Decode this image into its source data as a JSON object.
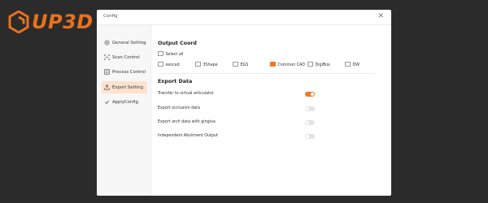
{
  "logo": {
    "text": "UP3D"
  },
  "dialog": {
    "title": "Config",
    "close_glyph": "✕"
  },
  "sidebar": {
    "items": [
      {
        "label": "General Setting",
        "icon": "gear-icon"
      },
      {
        "label": "Scan Control",
        "icon": "scan-icon"
      },
      {
        "label": "Process Control",
        "icon": "process-icon"
      },
      {
        "label": "Export Setting",
        "icon": "export-icon",
        "active": true
      },
      {
        "label": "ApplyConfig",
        "icon": "apply-config-icon"
      }
    ]
  },
  "output_coord": {
    "title": "Output Coord",
    "select_all": "Select all",
    "options": [
      {
        "label": "exocad",
        "checked": false
      },
      {
        "label": "3Shape",
        "checked": false
      },
      {
        "label": "EGS",
        "checked": false
      },
      {
        "label": "Common CAD",
        "checked": true
      },
      {
        "label": "DigiBox",
        "checked": false
      },
      {
        "label": "DW",
        "checked": false
      }
    ]
  },
  "export_data": {
    "title": "Export Data",
    "rows": [
      {
        "label": "Transfer to virtual articulator",
        "on": true
      },
      {
        "label": "Export occlusion data",
        "on": false
      },
      {
        "label": "Export arch data with gingiva",
        "on": false
      },
      {
        "label": "Independent Abutment Output",
        "on": false
      }
    ]
  },
  "colors": {
    "accent": "#f07a22",
    "logo": "#e8721c",
    "background": "#2b2b2b"
  }
}
